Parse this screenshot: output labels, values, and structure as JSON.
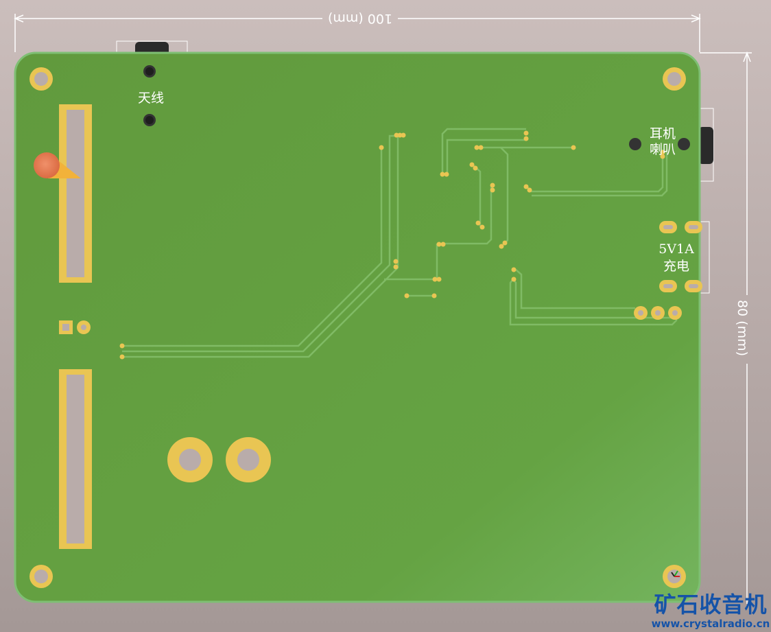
{
  "dimensions": {
    "width_label": "100 (mm)",
    "height_label": "80 (mm)"
  },
  "silkscreen": {
    "antenna": "天线",
    "headphone": "耳机",
    "speaker": "喇叭",
    "power_top": "5V1A",
    "power_bottom": "充电"
  },
  "watermark": {
    "title": "矿石收音机",
    "url": "www.crystalradio.cn"
  },
  "colors": {
    "board": "#67a443",
    "board_edge": "#7fbf74",
    "pad_gold": "#e9c553",
    "trace": "#86c06c",
    "background": "#b9acaa"
  }
}
